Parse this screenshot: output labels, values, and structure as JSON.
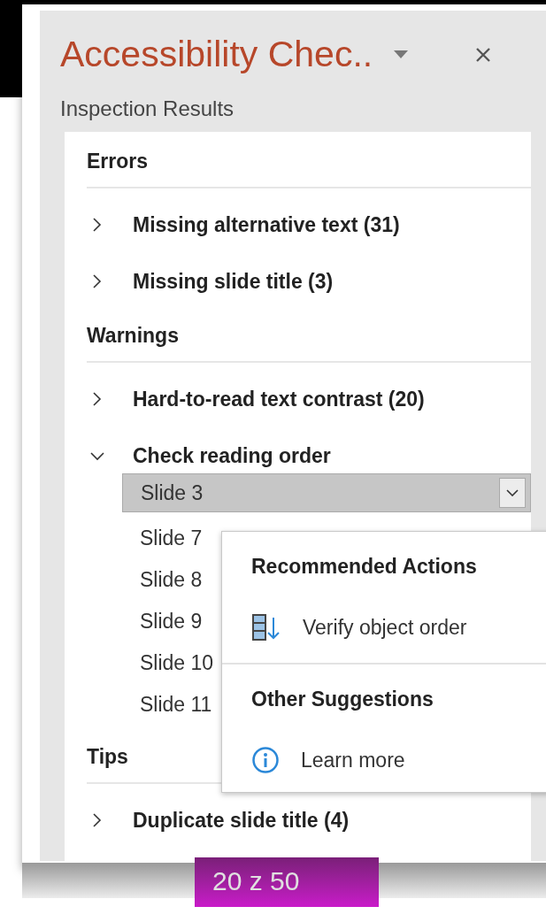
{
  "pane": {
    "title": "Accessibility Chec..",
    "subtitle": "Inspection Results",
    "sections": [
      {
        "heading": "Errors",
        "items": [
          {
            "label": "Missing alternative text (31)",
            "expanded": false
          },
          {
            "label": "Missing slide title (3)",
            "expanded": false
          }
        ]
      },
      {
        "heading": "Warnings",
        "items": [
          {
            "label": "Hard-to-read text contrast (20)",
            "expanded": false
          },
          {
            "label": "Check reading order",
            "expanded": true,
            "selected_slide": "Slide 3",
            "slides": [
              "Slide 7",
              "Slide 8",
              "Slide 9",
              "Slide 10",
              "Slide 11"
            ]
          }
        ]
      },
      {
        "heading": "Tips",
        "items": [
          {
            "label": "Duplicate slide title (4)",
            "expanded": false
          }
        ]
      }
    ]
  },
  "popup": {
    "groups": [
      {
        "heading": "Recommended Actions",
        "actions": [
          {
            "kind": "order",
            "label": "Verify object order"
          }
        ]
      },
      {
        "heading": "Other Suggestions",
        "actions": [
          {
            "kind": "info",
            "label": "Learn more"
          }
        ]
      }
    ]
  },
  "page_counter": "20 z 50"
}
